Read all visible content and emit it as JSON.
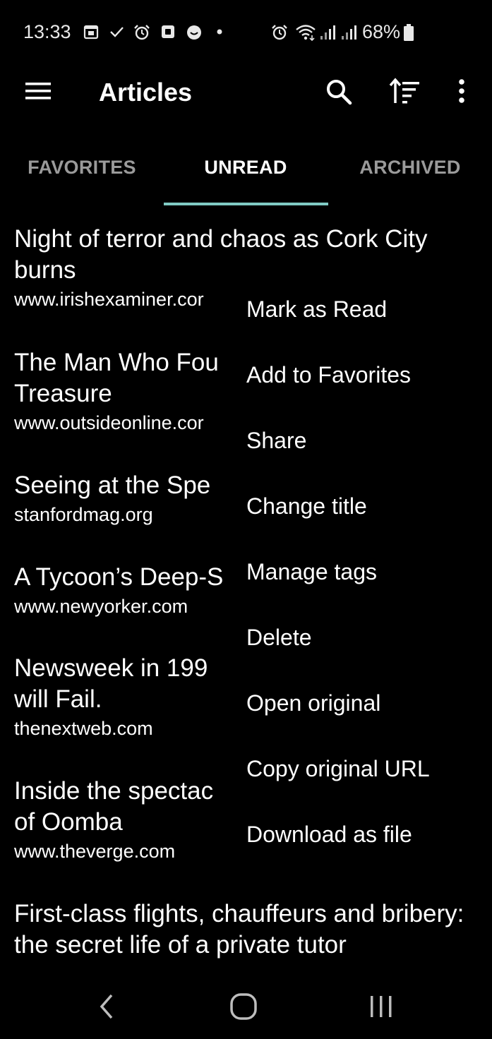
{
  "status_bar": {
    "time": "13:33",
    "battery": "68%",
    "left_icons": [
      "calendar-icon",
      "check-icon",
      "alarm-icon",
      "square-app-icon",
      "smiley-app-icon",
      "dot-icon"
    ],
    "right_icons": [
      "alarm-icon",
      "wifi-icon",
      "signal-icon",
      "signal-icon",
      "battery-icon"
    ]
  },
  "app_bar": {
    "title": "Articles",
    "icons": [
      "menu-icon",
      "search-icon",
      "sort-icon",
      "more-vert-icon"
    ]
  },
  "tabs": [
    {
      "label": "FAVORITES",
      "active": false
    },
    {
      "label": "UNREAD",
      "active": true
    },
    {
      "label": "ARCHIVED",
      "active": false
    }
  ],
  "articles": [
    {
      "title": "Night of terror and chaos as Cork City burns",
      "url": "www.irishexaminer.cor"
    },
    {
      "title": "The Man Who Fou Treasure",
      "url": "www.outsideonline.cor"
    },
    {
      "title": "Seeing at the Spe",
      "url": "stanfordmag.org"
    },
    {
      "title": "A Tycoon’s Deep-S",
      "url": "www.newyorker.com"
    },
    {
      "title": "Newsweek in 199 will Fail.",
      "url": "thenextweb.com"
    },
    {
      "title": "Inside the spectac of Oomba",
      "url": "www.theverge.com"
    },
    {
      "title": "First-class flights, chauffeurs and bribery: the secret life of a private tutor",
      "url": ""
    }
  ],
  "context_menu": [
    "Mark as Read",
    "Add to Favorites",
    "Share",
    "Change title",
    "Manage tags",
    "Delete",
    "Open original",
    "Copy original URL",
    "Download as file"
  ],
  "nav_bar": {
    "icons": [
      "back-icon",
      "home-icon",
      "recent-apps-icon"
    ]
  }
}
